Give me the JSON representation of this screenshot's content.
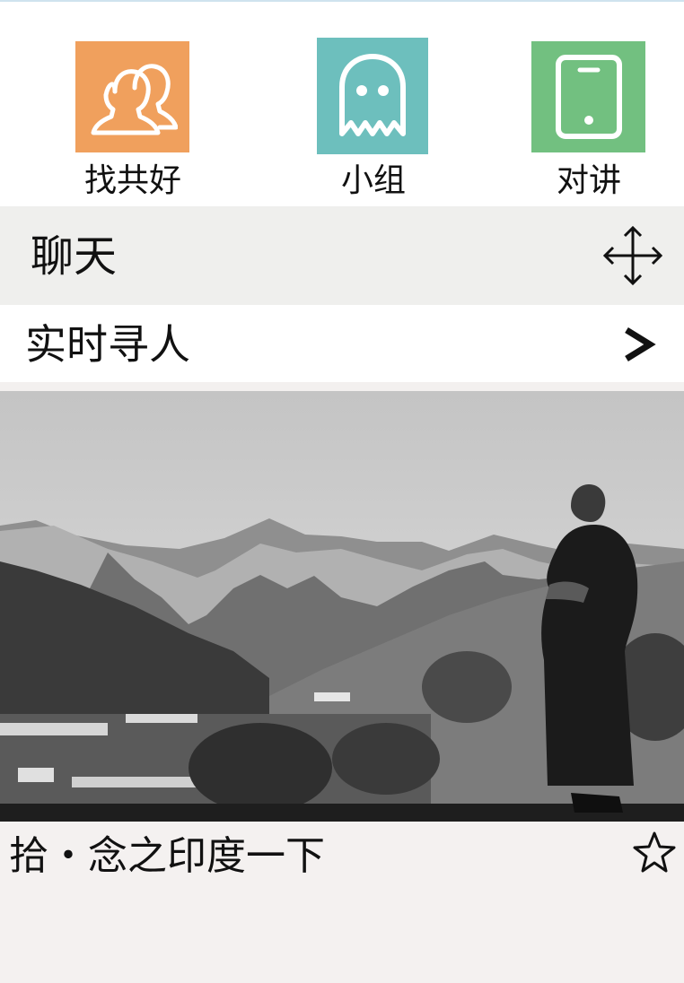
{
  "shortcuts": [
    {
      "label": "找共好",
      "icon": "contacts-icon",
      "color": "#f0a05d"
    },
    {
      "label": "小组",
      "icon": "ghost-icon",
      "color": "#6dbfbd"
    },
    {
      "label": "对讲",
      "icon": "tablet-icon",
      "color": "#72c080"
    }
  ],
  "chat": {
    "title": "聊天",
    "icon": "move-icon"
  },
  "find_people": {
    "title": "实时寻人",
    "icon": "chevron-right-icon"
  },
  "feature": {
    "image": "monk-mountain-photo",
    "caption": "拾・念之印度一下",
    "icon": "star-icon"
  }
}
